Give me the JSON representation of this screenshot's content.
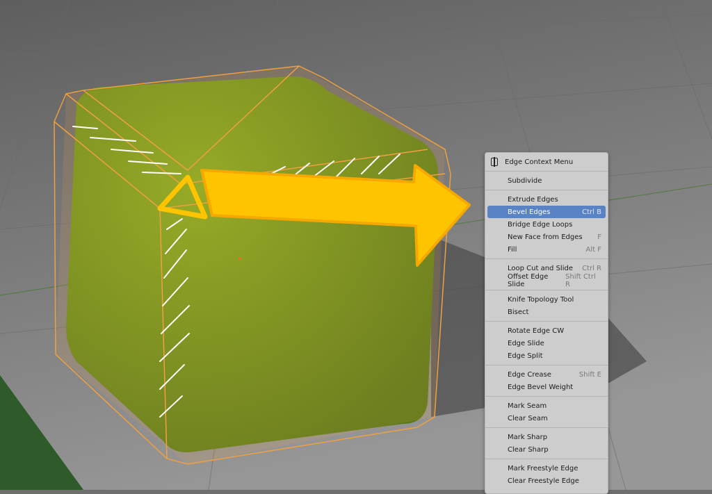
{
  "menu": {
    "title": "Edge Context Menu",
    "title_icon": "edge-select-icon",
    "highlight_color": "#5a83c6",
    "groups": [
      [
        {
          "label": "Subdivide",
          "shortcut": ""
        }
      ],
      [
        {
          "label": "Extrude Edges",
          "shortcut": ""
        },
        {
          "label": "Bevel Edges",
          "shortcut": "Ctrl B",
          "active": true
        },
        {
          "label": "Bridge Edge Loops",
          "shortcut": ""
        },
        {
          "label": "New Face from Edges",
          "shortcut": "F"
        },
        {
          "label": "Fill",
          "shortcut": "Alt F"
        }
      ],
      [
        {
          "label": "Loop Cut and Slide",
          "shortcut": "Ctrl R"
        },
        {
          "label": "Offset Edge Slide",
          "shortcut": "Shift Ctrl R"
        }
      ],
      [
        {
          "label": "Knife Topology Tool",
          "shortcut": ""
        },
        {
          "label": "Bisect",
          "shortcut": ""
        }
      ],
      [
        {
          "label": "Rotate Edge CW",
          "shortcut": ""
        },
        {
          "label": "Edge Slide",
          "shortcut": ""
        },
        {
          "label": "Edge Split",
          "shortcut": ""
        }
      ],
      [
        {
          "label": "Edge Crease",
          "shortcut": "Shift E"
        },
        {
          "label": "Edge Bevel Weight",
          "shortcut": ""
        }
      ],
      [
        {
          "label": "Mark Seam",
          "shortcut": ""
        },
        {
          "label": "Clear Seam",
          "shortcut": ""
        }
      ],
      [
        {
          "label": "Mark Sharp",
          "shortcut": ""
        },
        {
          "label": "Clear Sharp",
          "shortcut": ""
        }
      ],
      [
        {
          "label": "Mark Freestyle Edge",
          "shortcut": ""
        },
        {
          "label": "Clear Freestyle Edge",
          "shortcut": ""
        }
      ]
    ]
  },
  "colors": {
    "cube": "#6f9a1a",
    "wire": "#f0a040",
    "arrow": "#ffc400"
  }
}
